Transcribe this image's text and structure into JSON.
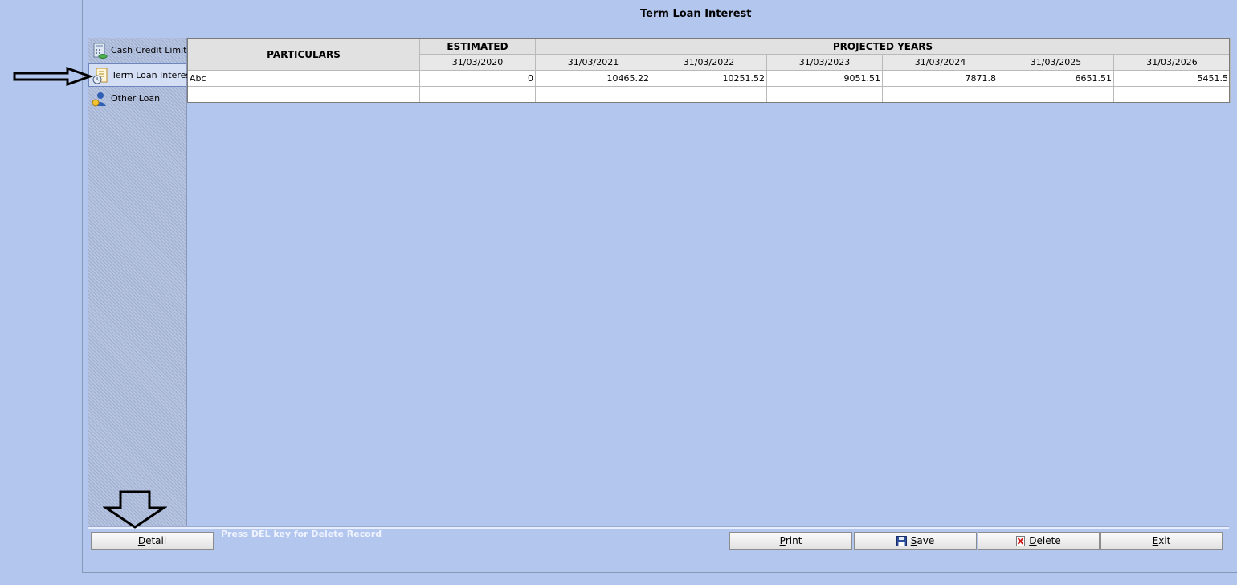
{
  "window": {
    "title": "Term Loan Interest"
  },
  "sidebar": {
    "items": [
      {
        "label": "Cash Credit Limit",
        "icon": "cash-credit-icon",
        "active": false
      },
      {
        "label": "Term Loan Interest",
        "icon": "term-loan-icon",
        "active": true
      },
      {
        "label": "Other Loan",
        "icon": "other-loan-icon",
        "active": false
      }
    ]
  },
  "grid": {
    "header": {
      "particulars": "PARTICULARS",
      "estimated": "ESTIMATED",
      "projected": "PROJECTED YEARS",
      "dates": [
        "31/03/2020",
        "31/03/2021",
        "31/03/2022",
        "31/03/2023",
        "31/03/2024",
        "31/03/2025",
        "31/03/2026"
      ]
    },
    "rows": [
      {
        "particular": "Abc",
        "values": [
          "0",
          "10465.22",
          "10251.52",
          "9051.51",
          "7871.8",
          "6651.51",
          "5451.5"
        ]
      },
      {
        "particular": "",
        "values": [
          "",
          "",
          "",
          "",
          "",
          "",
          ""
        ]
      }
    ]
  },
  "footer": {
    "hint": "Press DEL key for Delete Record",
    "detail": {
      "accel": "D",
      "rest": "etail"
    },
    "print": {
      "accel": "P",
      "rest": "rint"
    },
    "save": {
      "accel": "S",
      "rest": "ave"
    },
    "delete": {
      "accel": "D",
      "rest": "elete"
    },
    "exit": {
      "accel": "E",
      "rest": "xit"
    }
  },
  "colors": {
    "background": "#b3c6ee",
    "header": "#e1e1e1",
    "hint_text": "#eef3ff"
  }
}
